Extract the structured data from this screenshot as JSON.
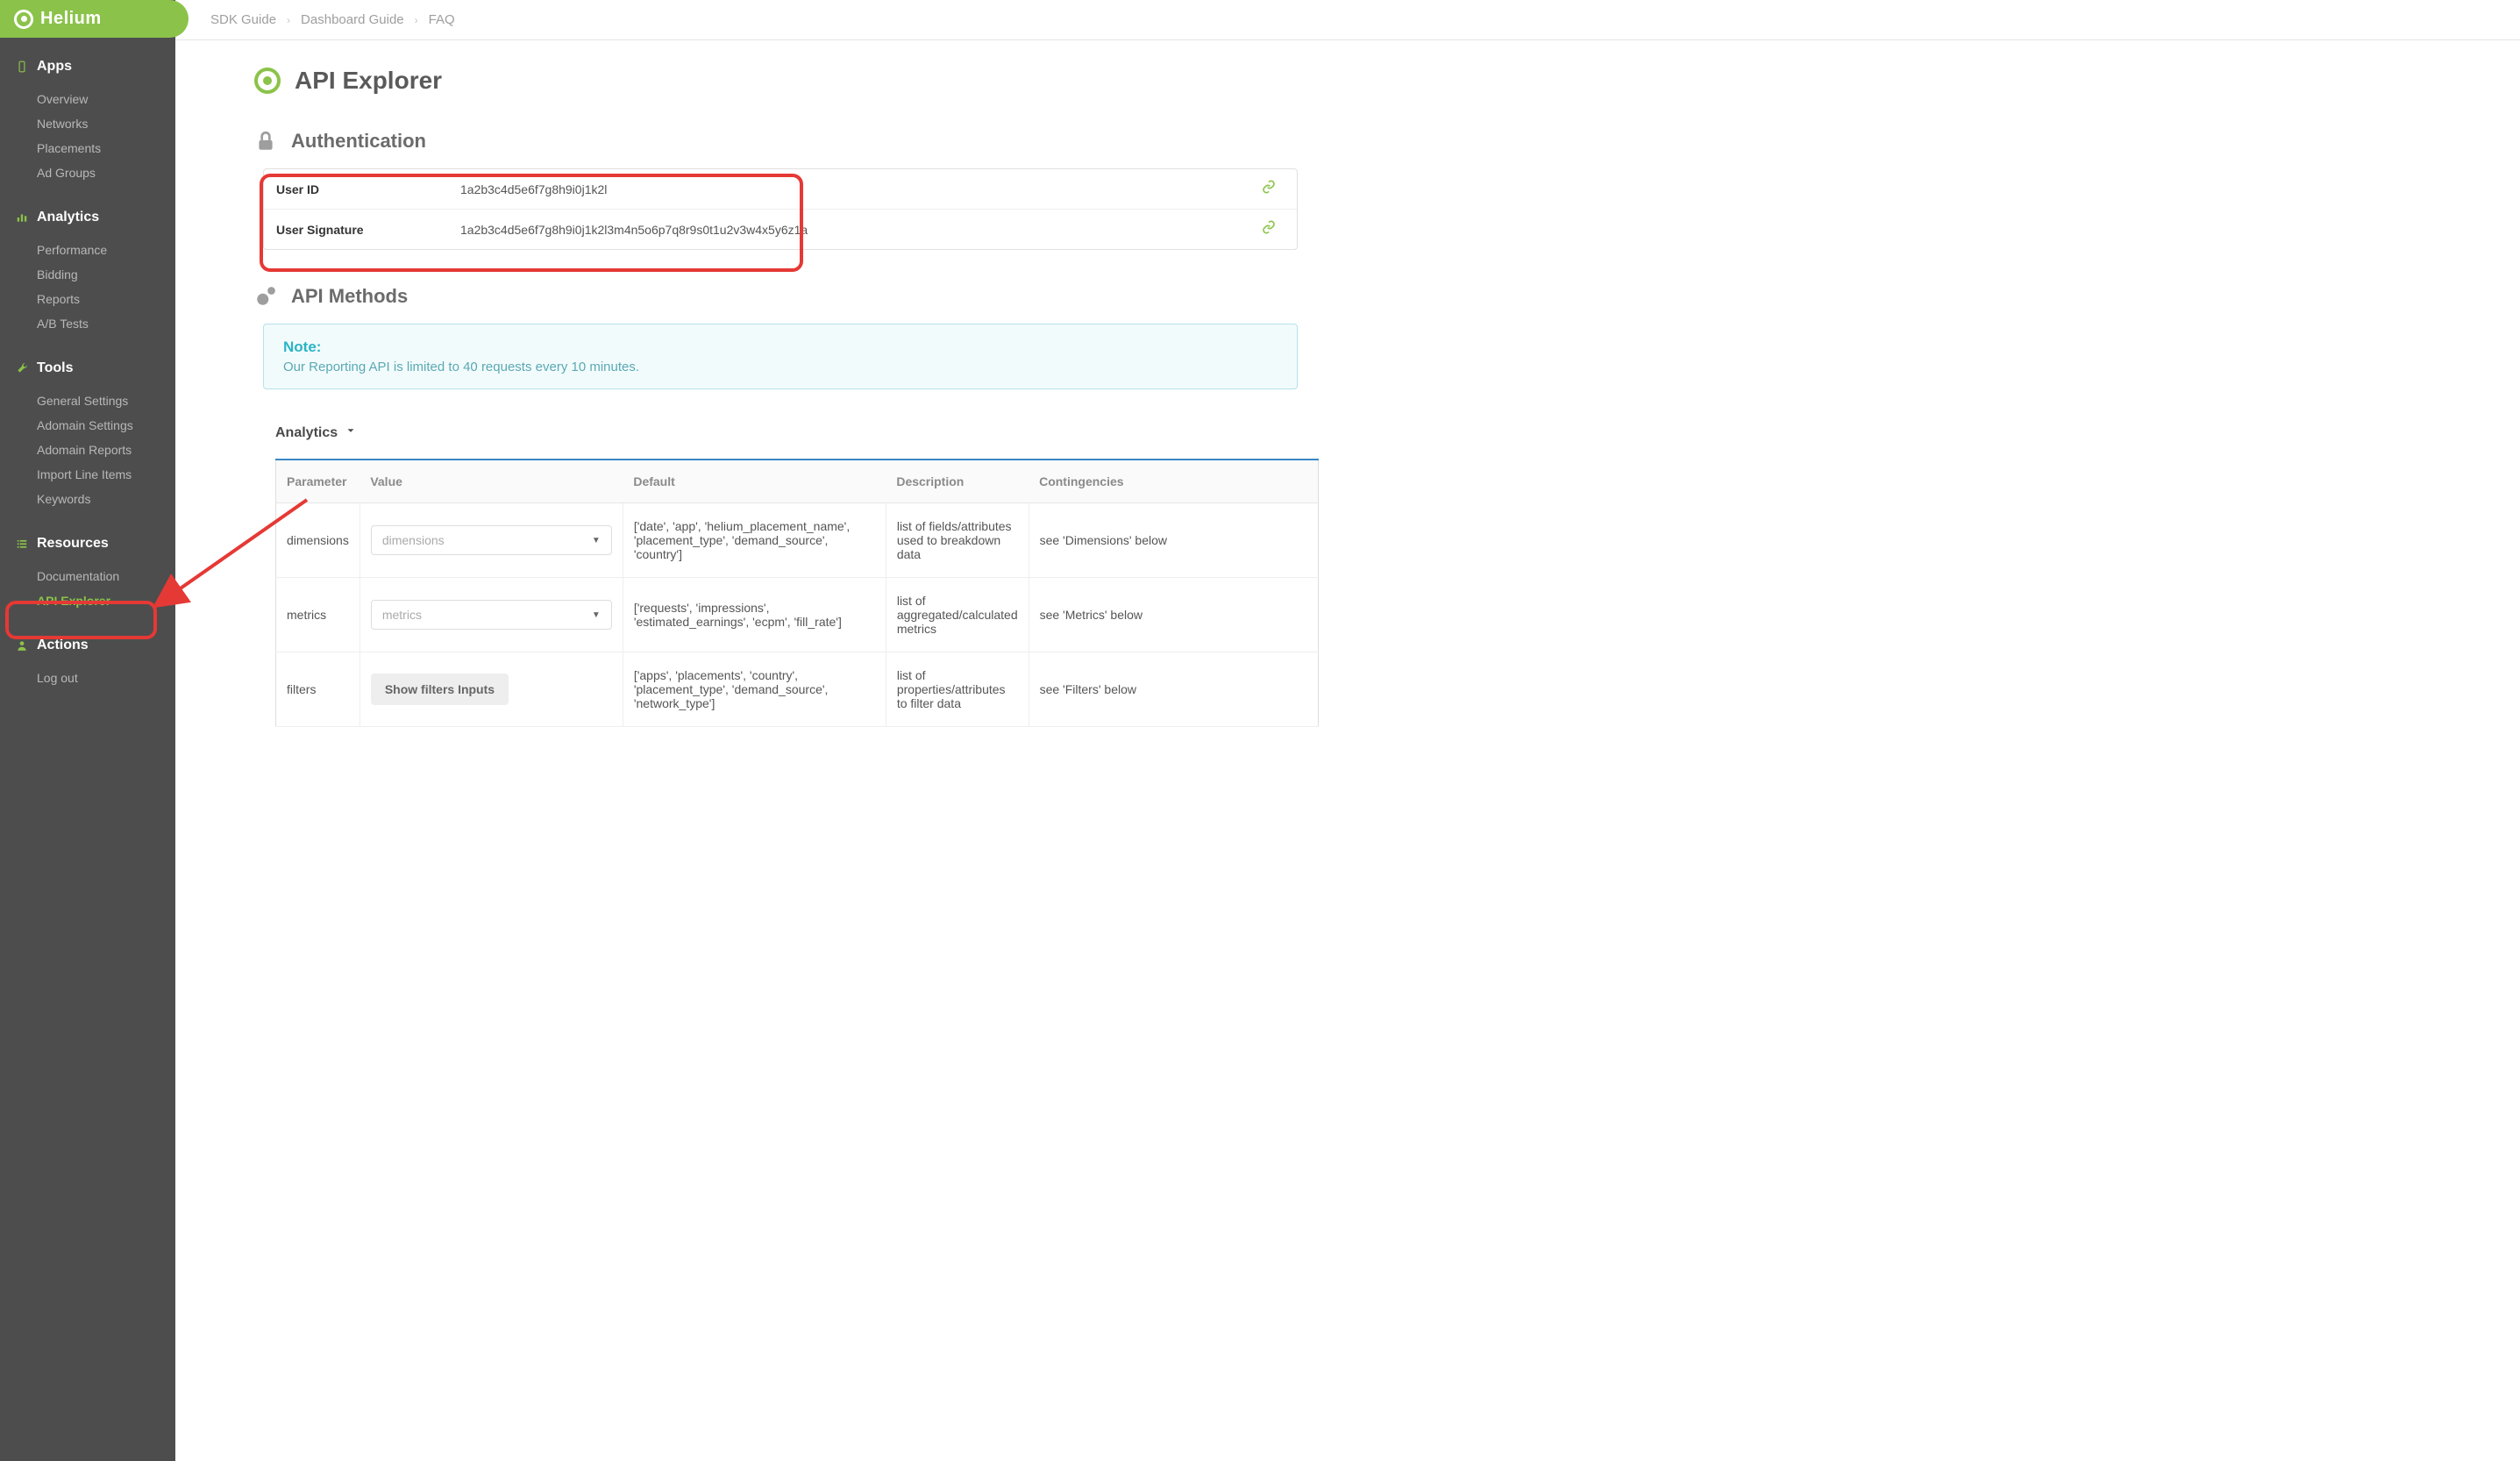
{
  "brand": "Helium",
  "topbar": {
    "crumbs": [
      "SDK Guide",
      "Dashboard Guide",
      "FAQ"
    ]
  },
  "sidebar": {
    "sections": [
      {
        "title": "Apps",
        "items": [
          "Overview",
          "Networks",
          "Placements",
          "Ad Groups"
        ]
      },
      {
        "title": "Analytics",
        "items": [
          "Performance",
          "Bidding",
          "Reports",
          "A/B Tests"
        ]
      },
      {
        "title": "Tools",
        "items": [
          "General Settings",
          "Adomain Settings",
          "Adomain Reports",
          "Import Line Items",
          "Keywords"
        ]
      },
      {
        "title": "Resources",
        "items": [
          "Documentation",
          "API Explorer"
        ]
      },
      {
        "title": "Actions",
        "items": [
          "Log out"
        ]
      }
    ]
  },
  "page": {
    "title": "API Explorer",
    "auth_section": "Authentication",
    "methods_section": "API Methods",
    "auth": [
      {
        "label": "User ID",
        "value": "1a2b3c4d5e6f7g8h9i0j1k2l"
      },
      {
        "label": "User Signature",
        "value": "1a2b3c4d5e6f7g8h9i0j1k2l3m4n5o6p7q8r9s0t1u2v3w4x5y6z1a"
      }
    ],
    "note_title": "Note:",
    "note_text": "Our Reporting API is limited to 40 requests every 10 minutes.",
    "accordion": "Analytics",
    "table": {
      "headers": [
        "Parameter",
        "Value",
        "Default",
        "Description",
        "Contingencies"
      ],
      "rows": [
        {
          "param": "dimensions",
          "value_ph": "dimensions",
          "value_type": "dropdown",
          "default": "['date', 'app', 'helium_placement_name', 'placement_type', 'demand_source', 'country']",
          "desc": "list of fields/attributes used to breakdown data",
          "cont": "see 'Dimensions' below"
        },
        {
          "param": "metrics",
          "value_ph": "metrics",
          "value_type": "dropdown",
          "default": "['requests', 'impressions', 'estimated_earnings', 'ecpm', 'fill_rate']",
          "desc": "list of aggregated/calculated metrics",
          "cont": "see 'Metrics' below"
        },
        {
          "param": "filters",
          "value_ph": "Show filters Inputs",
          "value_type": "button",
          "default": "['apps', 'placements', 'country', 'placement_type', 'demand_source', 'network_type']",
          "desc": "list of properties/attributes to filter data",
          "cont": "see 'Filters' below"
        }
      ]
    }
  }
}
